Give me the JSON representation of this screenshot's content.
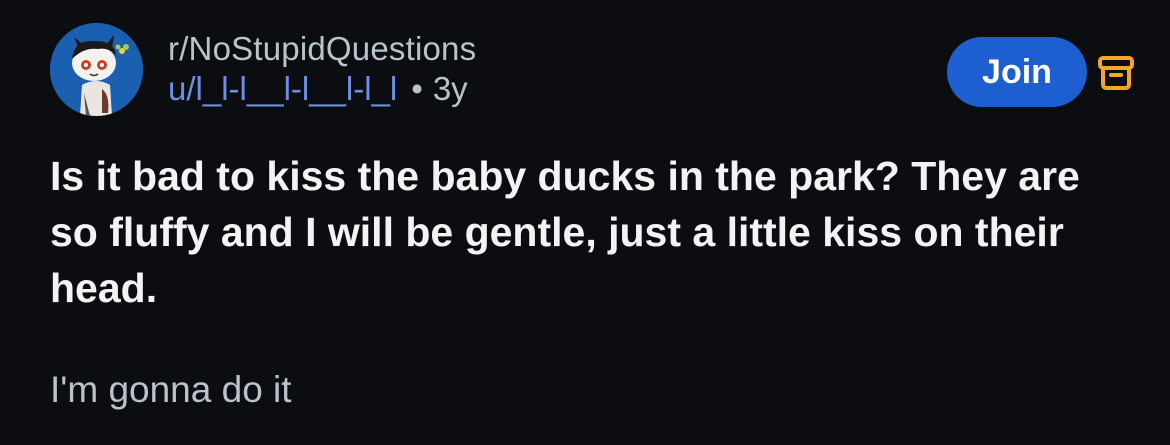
{
  "post": {
    "subreddit": "r/NoStupidQuestions",
    "author": "u/l_l-l__l-l__l-l_l",
    "separator": "•",
    "age": "3y",
    "join_label": "Join",
    "title": "Is it bad to kiss the baby ducks in the park? They are so fluffy and I will be gentle, just a little kiss on their head.",
    "body": "I'm gonna do it"
  },
  "colors": {
    "background": "#0c0d10",
    "join_button": "#1d5fd0",
    "author": "#6e8fe6",
    "archive_icon": "#f5a623",
    "avatar_bg": "#1b5fb0"
  },
  "icons": {
    "avatar": "snoo-avatar",
    "archive": "archive-icon"
  }
}
